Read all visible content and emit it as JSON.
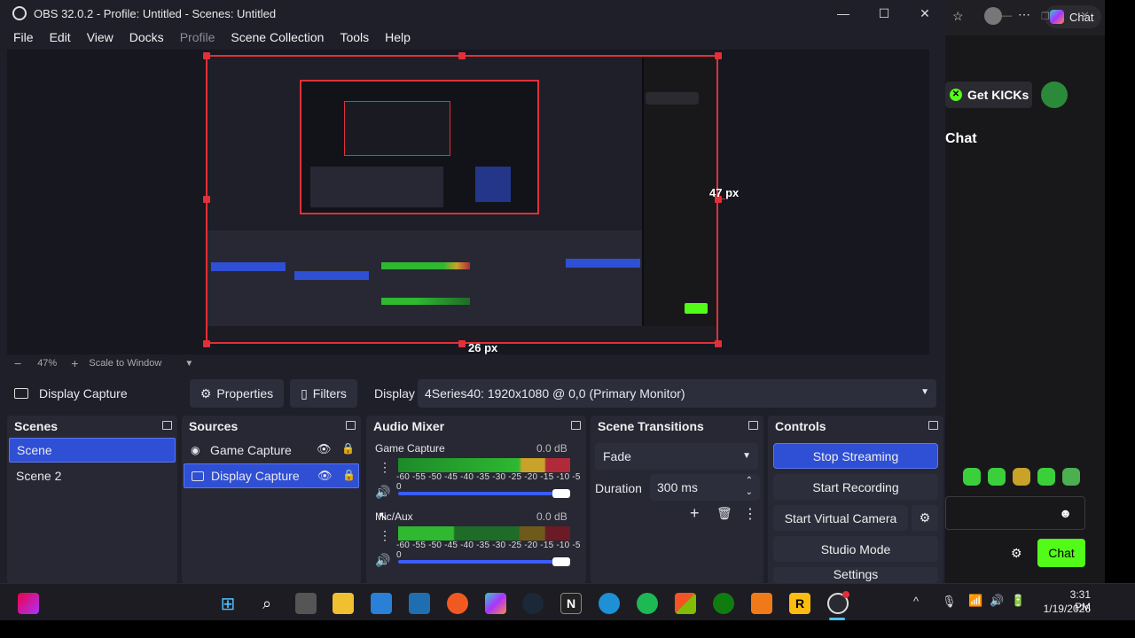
{
  "window": {
    "title": "OBS 32.0.2 - Profile: Untitled - Scenes: Untitled",
    "minimize_icon": "minimize-icon",
    "maximize_icon": "maximize-icon",
    "close_icon": "close-icon"
  },
  "menu": {
    "file": "File",
    "edit": "Edit",
    "view": "View",
    "docks": "Docks",
    "profile": "Profile",
    "scene_collection": "Scene Collection",
    "tools": "Tools",
    "help": "Help"
  },
  "preview": {
    "right_px": "47 px",
    "bottom_px": "26 px"
  },
  "zoom": {
    "minus": "−",
    "level": "47%",
    "plus": "+",
    "mode": "Scale to Window"
  },
  "source_toolbar": {
    "source_name": "Display Capture",
    "properties": "Properties",
    "filters": "Filters",
    "display_label": "Display",
    "display_value": "4Series40: 1920x1080 @ 0,0 (Primary Monitor)"
  },
  "scenes": {
    "title": "Scenes",
    "items": [
      "Scene",
      "Scene 2"
    ]
  },
  "sources": {
    "title": "Sources",
    "items": [
      {
        "name": "Game Capture",
        "icon": "gamepad-icon"
      },
      {
        "name": "Display Capture",
        "icon": "monitor-icon"
      }
    ]
  },
  "audio_mixer": {
    "title": "Audio Mixer",
    "channels": [
      {
        "name": "Game Capture",
        "db": "0.0 dB",
        "level": 0.78
      },
      {
        "name": "Mic/Aux",
        "db": "0.0 dB",
        "level": 0.35
      }
    ],
    "ticks": "-60 -55 -50 -45 -40 -35 -30 -25 -20 -15 -10 -5 0"
  },
  "transitions": {
    "title": "Scene Transitions",
    "selected": "Fade",
    "duration_label": "Duration",
    "duration_value": "300 ms"
  },
  "controls": {
    "title": "Controls",
    "stop_streaming": "Stop Streaming",
    "start_recording": "Start Recording",
    "start_virtual_camera": "Start Virtual Camera",
    "studio_mode": "Studio Mode",
    "settings": "Settings"
  },
  "browser_side": {
    "chat_tab": "Chat",
    "get_kicks": "Get KICKs",
    "chat_heading": "Chat",
    "chat_button": "Chat"
  },
  "taskbar": {
    "time": "3:31 PM",
    "date": "1/19/2026"
  },
  "colors": {
    "accent": "#2f4fd4",
    "red_border": "#e0303a",
    "kick_green": "#53fc18"
  }
}
